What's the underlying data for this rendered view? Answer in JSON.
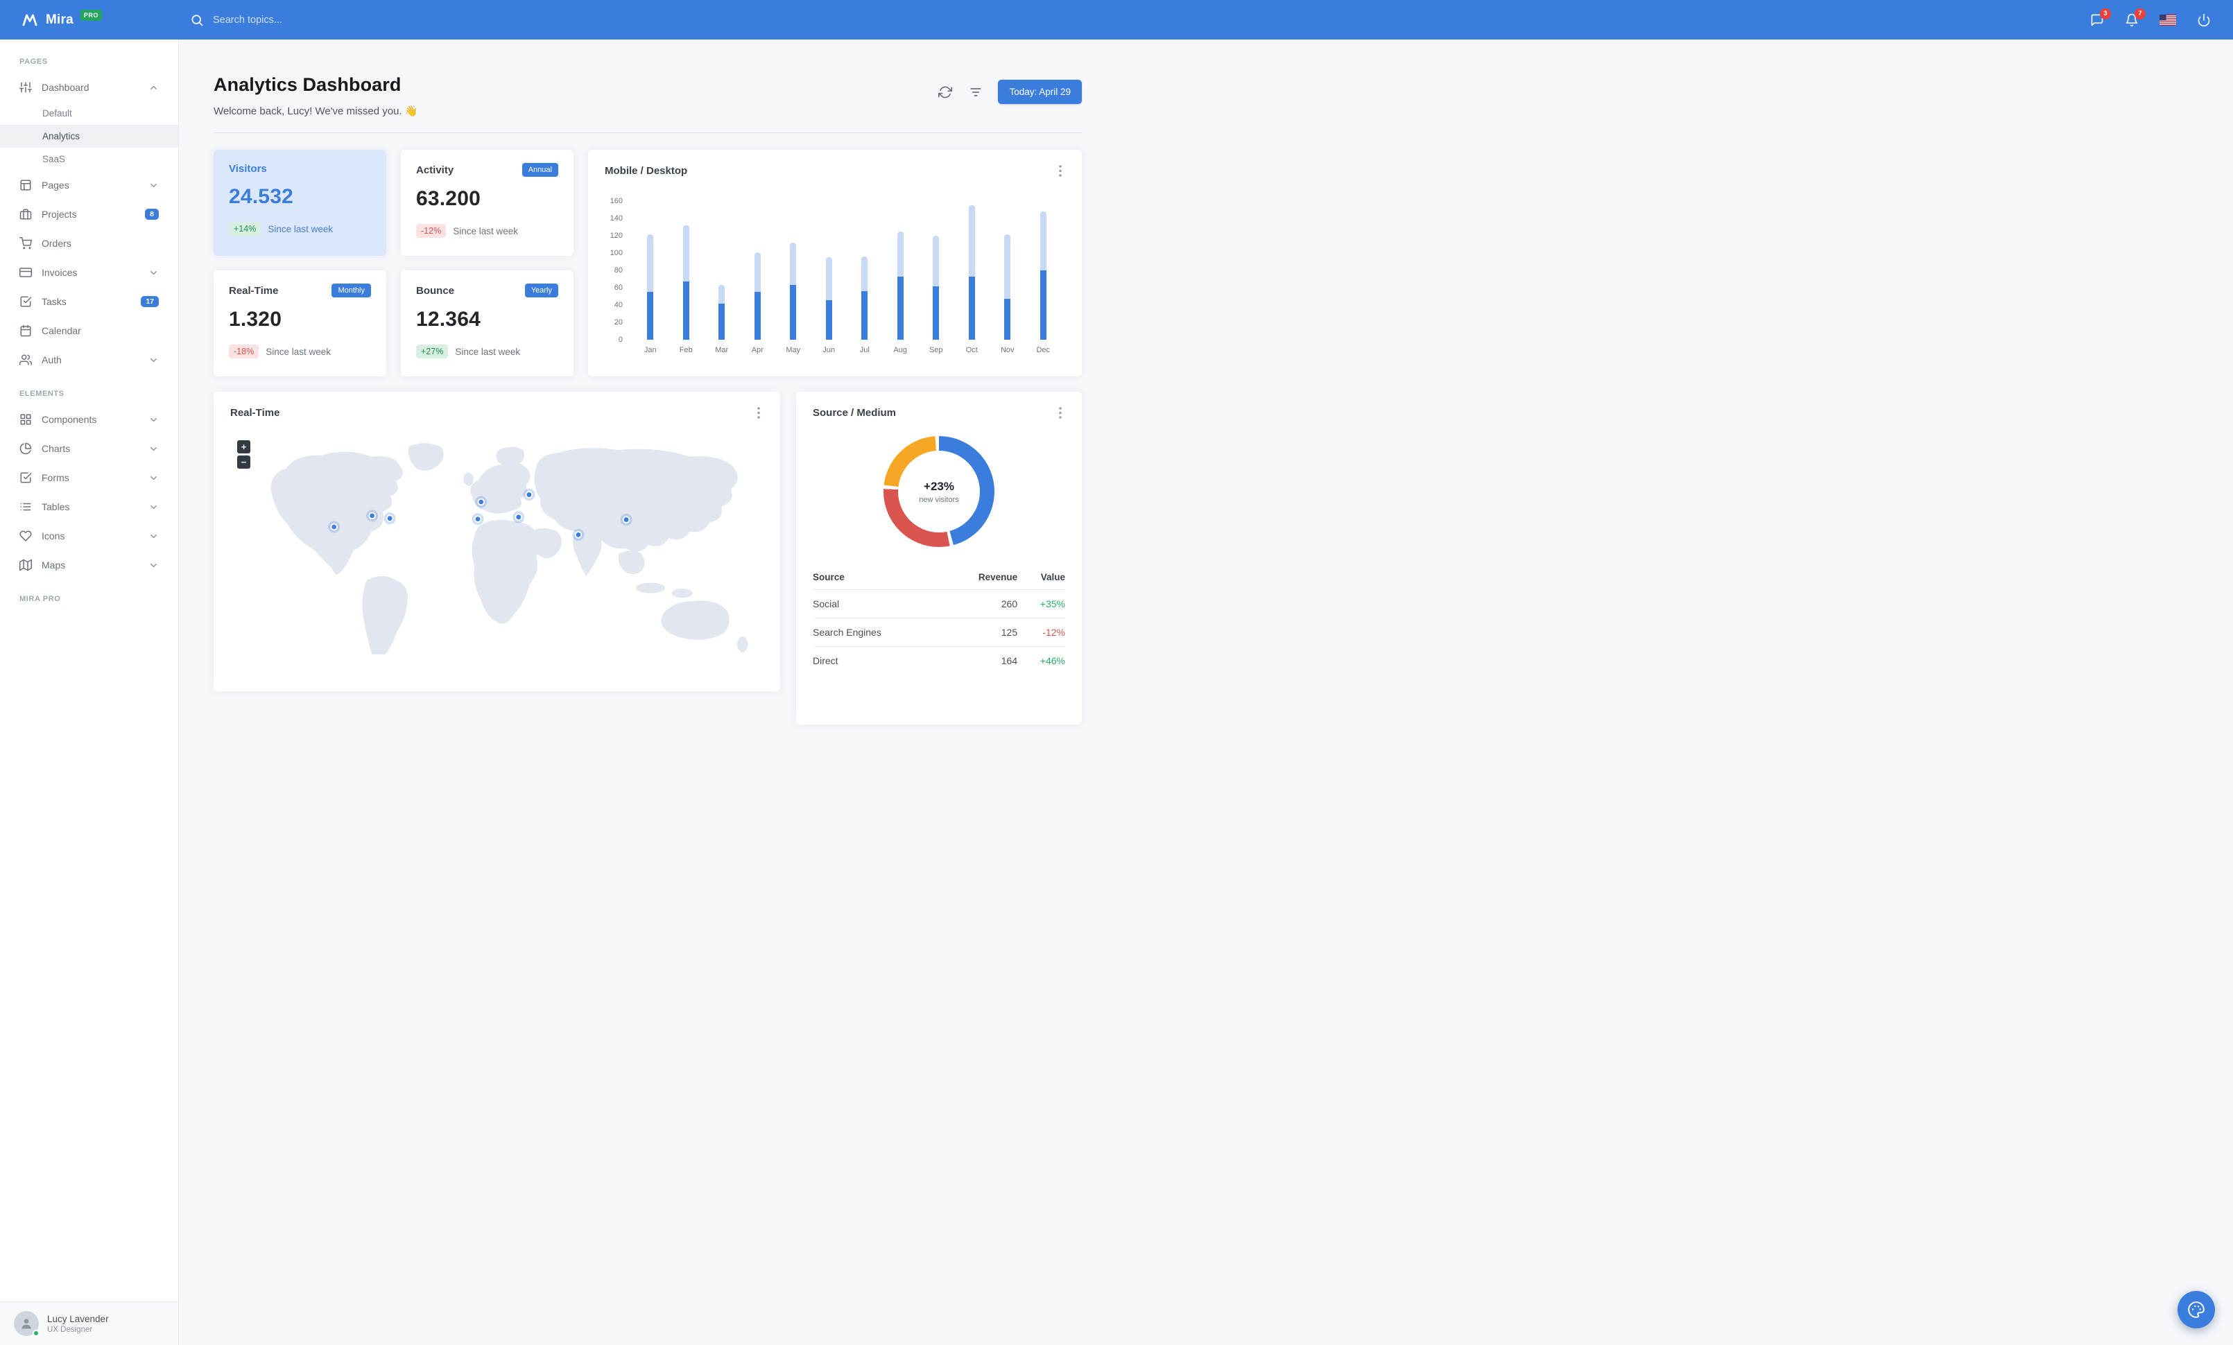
{
  "colors": {
    "primary": "#3b7ddd",
    "success": "#28a745",
    "danger": "#d9534f",
    "warning": "#f5a623",
    "pro_badge_green": "#22a55f",
    "bar_light": "#c7d9f4",
    "highlight_card_bg": "#dbe7fb"
  },
  "navbar": {
    "logo": "Mira",
    "pro_badge": "PRO",
    "search_placeholder": "Search topics...",
    "messages_badge": "3",
    "notifications_badge": "7"
  },
  "sidebar": {
    "sections": [
      {
        "label": "PAGES",
        "items": [
          {
            "label": "Dashboard",
            "icon": "sliders-icon",
            "chevron": "up",
            "children": [
              {
                "label": "Default",
                "active": false
              },
              {
                "label": "Analytics",
                "active": true
              },
              {
                "label": "SaaS",
                "active": false
              }
            ]
          },
          {
            "label": "Pages",
            "icon": "layout-icon",
            "chevron": "down"
          },
          {
            "label": "Projects",
            "icon": "briefcase-icon",
            "badge": "8"
          },
          {
            "label": "Orders",
            "icon": "shopping-cart-icon"
          },
          {
            "label": "Invoices",
            "icon": "credit-card-icon",
            "chevron": "down"
          },
          {
            "label": "Tasks",
            "icon": "check-square-icon",
            "badge": "17"
          },
          {
            "label": "Calendar",
            "icon": "calendar-icon"
          },
          {
            "label": "Auth",
            "icon": "users-icon",
            "chevron": "down"
          }
        ]
      },
      {
        "label": "ELEMENTS",
        "items": [
          {
            "label": "Components",
            "icon": "grid-icon",
            "chevron": "down"
          },
          {
            "label": "Charts",
            "icon": "pie-chart-icon",
            "chevron": "down"
          },
          {
            "label": "Forms",
            "icon": "check-square-icon",
            "chevron": "down"
          },
          {
            "label": "Tables",
            "icon": "list-icon",
            "chevron": "down"
          },
          {
            "label": "Icons",
            "icon": "heart-icon",
            "chevron": "down"
          },
          {
            "label": "Maps",
            "icon": "map-icon",
            "chevron": "down"
          }
        ]
      },
      {
        "label": "MIRA PRO",
        "items": []
      }
    ],
    "user": {
      "name": "Lucy Lavender",
      "role": "UX Designer",
      "status": "online"
    }
  },
  "header": {
    "title": "Analytics Dashboard",
    "subtitle": "Welcome back, Lucy! We've missed you.",
    "emoji": "👋",
    "date_button": "Today: April 29"
  },
  "stats": [
    {
      "title": "Visitors",
      "value": "24.532",
      "delta": "+14%",
      "delta_type": "positive",
      "note": "Since last week",
      "highlight": true
    },
    {
      "title": "Activity",
      "badge": "Annual",
      "value": "63.200",
      "delta": "-12%",
      "delta_type": "negative",
      "note": "Since last week",
      "highlight": false
    },
    {
      "title": "Real-Time",
      "badge": "Monthly",
      "value": "1.320",
      "delta": "-18%",
      "delta_type": "negative",
      "note": "Since last week",
      "highlight": false
    },
    {
      "title": "Bounce",
      "badge": "Yearly",
      "value": "12.364",
      "delta": "+27%",
      "delta_type": "positive",
      "note": "Since last week",
      "highlight": false
    }
  ],
  "chart_data": [
    {
      "type": "bar",
      "stacked": true,
      "title": "Mobile / Desktop",
      "categories": [
        "Jan",
        "Feb",
        "Mar",
        "Apr",
        "May",
        "Jun",
        "Jul",
        "Aug",
        "Sep",
        "Oct",
        "Nov",
        "Dec"
      ],
      "series": [
        {
          "name": "Desktop",
          "color": "#3b7ddd",
          "values": [
            55,
            67,
            42,
            55,
            63,
            46,
            56,
            73,
            62,
            73,
            47,
            80
          ]
        },
        {
          "name": "Mobile",
          "color": "#c7d9f4",
          "values": [
            67,
            65,
            21,
            46,
            49,
            49,
            40,
            52,
            58,
            82,
            75,
            68
          ]
        }
      ],
      "xlabel": "",
      "ylabel": "",
      "ylim": [
        0,
        160
      ],
      "ytick_step": 20,
      "legend": "none"
    },
    {
      "type": "pie",
      "donut": true,
      "title": "Source / Medium",
      "center_label": "+23%",
      "center_sub": "new visitors",
      "slices": [
        {
          "label": "Social",
          "value": 260,
          "color": "#3b7ddd"
        },
        {
          "label": "Direct",
          "value": 164,
          "color": "#d9534f"
        },
        {
          "label": "Search Engines",
          "value": 125,
          "color": "#f5a623"
        }
      ]
    }
  ],
  "realtime": {
    "title": "Real-Time",
    "zoom_in": "+",
    "zoom_out": "−",
    "markers": [
      [
        158,
        151
      ],
      [
        216,
        134
      ],
      [
        243,
        138
      ],
      [
        377,
        139
      ],
      [
        382,
        113
      ],
      [
        439,
        136
      ],
      [
        455,
        102
      ],
      [
        530,
        163
      ],
      [
        603,
        140
      ]
    ]
  },
  "source_medium": {
    "title": "Source / Medium",
    "table": {
      "headers": [
        "Source",
        "Revenue",
        "Value"
      ],
      "rows": [
        {
          "source": "Social",
          "revenue": "260",
          "value": "+35%",
          "value_type": "positive"
        },
        {
          "source": "Search Engines",
          "revenue": "125",
          "value": "-12%",
          "value_type": "negative"
        },
        {
          "source": "Direct",
          "revenue": "164",
          "value": "+46%",
          "value_type": "positive"
        }
      ]
    }
  }
}
